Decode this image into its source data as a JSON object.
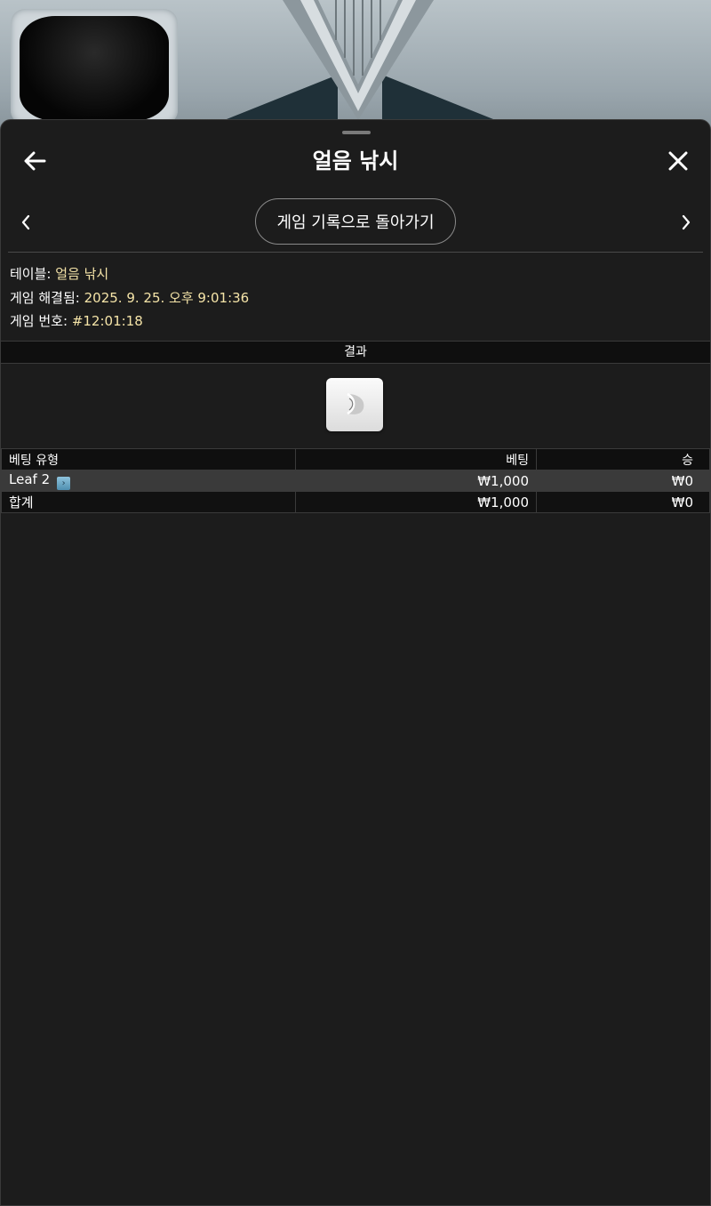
{
  "header": {
    "title": "얼음 낚시",
    "back_nav_label": "게임 기록으로 돌아가기"
  },
  "info": {
    "table_label": "테이블:",
    "table_value": "얼음 낚시",
    "resolved_label": "게임 해결됨:",
    "resolved_value": "2025. 9. 25. 오후 9:01:36",
    "game_no_label": "게임 번호:",
    "game_no_value": "#12:01:18"
  },
  "result": {
    "heading": "결과",
    "icon": "leaf-moon-icon"
  },
  "bets_table": {
    "columns": [
      "베팅 유형",
      "베팅",
      "승"
    ],
    "rows": [
      {
        "type": "Leaf 2",
        "bet": "₩1,000",
        "win": "₩0",
        "icon": "leaf-2-icon"
      }
    ],
    "total": {
      "label": "합계",
      "bet": "₩1,000",
      "win": "₩0"
    }
  },
  "colors": {
    "sheet_bg": "#1c1c1c",
    "info_value": "#f5e4a8",
    "highlight_row": "#3a3a3a"
  }
}
